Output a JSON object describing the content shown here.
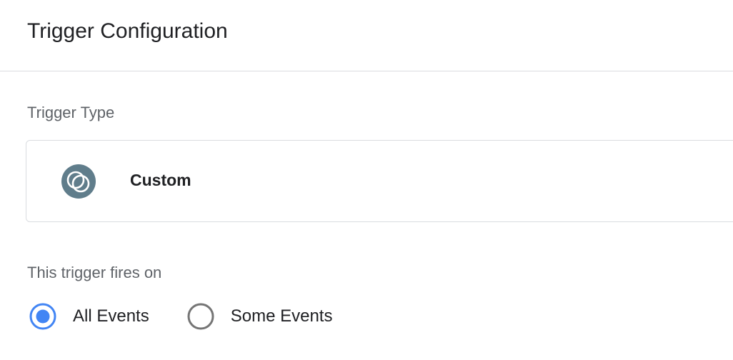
{
  "header": {
    "title": "Trigger Configuration"
  },
  "trigger_type": {
    "section_label": "Trigger Type",
    "selected_type": "Custom",
    "icon": "custom-trigger-icon",
    "icon_color": "#607d8b"
  },
  "fires_on": {
    "section_label": "This trigger fires on",
    "options": [
      {
        "label": "All Events",
        "selected": true
      },
      {
        "label": "Some Events",
        "selected": false
      }
    ],
    "accent_color": "#4285f4",
    "unselected_color": "#757575"
  }
}
